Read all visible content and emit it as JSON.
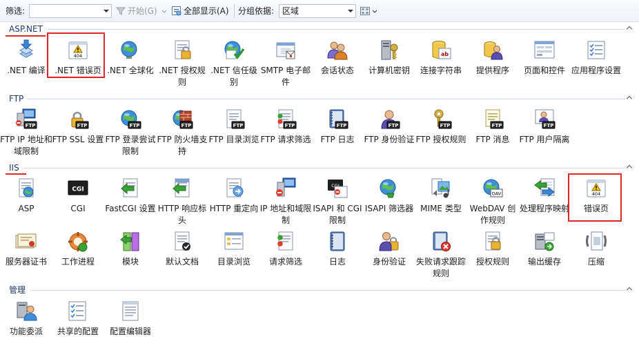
{
  "toolbar": {
    "filter_label": "筛选:",
    "filter_value": "",
    "start_label": "开始(G)",
    "show_all_label": "全部显示(A)",
    "group_by_label": "分组依据:",
    "group_by_value": "区域"
  },
  "groups": [
    {
      "title": "ASP.NET",
      "items": [
        {
          "label": ".NET 编译",
          "icon": "download-icon"
        },
        {
          "label": ".NET 错误页",
          "icon": "warning-404-icon"
        },
        {
          "label": ".NET 全球化",
          "icon": "globe-icon"
        },
        {
          "label": ".NET 授权规则",
          "icon": "lock-doc-icon"
        },
        {
          "label": ".NET 信任级别",
          "icon": "trust-check-icon"
        },
        {
          "label": "SMTP 电子邮件",
          "icon": "email-icon"
        },
        {
          "label": "会话状态",
          "icon": "users-icon"
        },
        {
          "label": "计算机密钥",
          "icon": "machine-key-icon"
        },
        {
          "label": "连接字符串",
          "icon": "connection-string-icon"
        },
        {
          "label": "提供程序",
          "icon": "provider-icon"
        },
        {
          "label": "页面和控件",
          "icon": "page-controls-icon"
        },
        {
          "label": "应用程序设置",
          "icon": "app-settings-icon"
        }
      ]
    },
    {
      "title": "FTP",
      "items": [
        {
          "label": "FTP IP 地址和域限制",
          "icon": "ftp-ip-icon"
        },
        {
          "label": "FTP SSL 设置",
          "icon": "ftp-lock-icon"
        },
        {
          "label": "FTP 登录尝试限制",
          "icon": "ftp-globe-icon"
        },
        {
          "label": "FTP 防火墙支持",
          "icon": "ftp-firewall-icon"
        },
        {
          "label": "FTP 目录浏览",
          "icon": "ftp-browse-icon"
        },
        {
          "label": "FTP 请求筛选",
          "icon": "ftp-filter-icon"
        },
        {
          "label": "FTP 日志",
          "icon": "ftp-log-icon"
        },
        {
          "label": "FTP 身份验证",
          "icon": "ftp-auth-icon"
        },
        {
          "label": "FTP 授权规则",
          "icon": "ftp-key-icon"
        },
        {
          "label": "FTP 消息",
          "icon": "ftp-message-icon"
        },
        {
          "label": "FTP 用户隔离",
          "icon": "ftp-user-icon"
        }
      ]
    },
    {
      "title": "IIS",
      "items": [
        {
          "label": "ASP",
          "icon": "asp-icon"
        },
        {
          "label": "CGI",
          "icon": "cgi-icon"
        },
        {
          "label": "FastCGI 设置",
          "icon": "fastcgi-icon"
        },
        {
          "label": "HTTP 响应标头",
          "icon": "http-headers-icon"
        },
        {
          "label": "HTTP 重定向",
          "icon": "http-redirect-icon"
        },
        {
          "label": "IP 地址和域限制",
          "icon": "ip-restrict-icon"
        },
        {
          "label": "ISAPI 和 CGI 限制",
          "icon": "isapi-cgi-icon"
        },
        {
          "label": "ISAPI 筛选器",
          "icon": "isapi-filter-icon"
        },
        {
          "label": "MIME 类型",
          "icon": "mime-icon"
        },
        {
          "label": "WebDAV 创作规则",
          "icon": "webdav-icon"
        },
        {
          "label": "处理程序映射",
          "icon": "handler-icon"
        },
        {
          "label": "错误页",
          "icon": "warning-404-icon"
        },
        {
          "label": "服务器证书",
          "icon": "certificate-icon"
        },
        {
          "label": "工作进程",
          "icon": "worker-process-icon"
        },
        {
          "label": "模块",
          "icon": "modules-icon"
        },
        {
          "label": "默认文档",
          "icon": "default-doc-icon"
        },
        {
          "label": "目录浏览",
          "icon": "dir-browse-icon"
        },
        {
          "label": "请求筛选",
          "icon": "request-filter-icon"
        },
        {
          "label": "日志",
          "icon": "log-icon"
        },
        {
          "label": "身份验证",
          "icon": "auth-icon"
        },
        {
          "label": "失败请求跟踪规则",
          "icon": "failed-trace-icon"
        },
        {
          "label": "授权规则",
          "icon": "authz-icon"
        },
        {
          "label": "输出缓存",
          "icon": "output-cache-icon"
        },
        {
          "label": "压缩",
          "icon": "compression-icon"
        }
      ]
    },
    {
      "title": "管理",
      "items": [
        {
          "label": "功能委派",
          "icon": "delegation-icon"
        },
        {
          "label": "共享的配置",
          "icon": "shared-config-icon"
        },
        {
          "label": "配置编辑器",
          "icon": "config-editor-icon"
        }
      ]
    }
  ],
  "colors": {
    "highlight": "#e0262b",
    "group_title": "#1f3a70"
  }
}
